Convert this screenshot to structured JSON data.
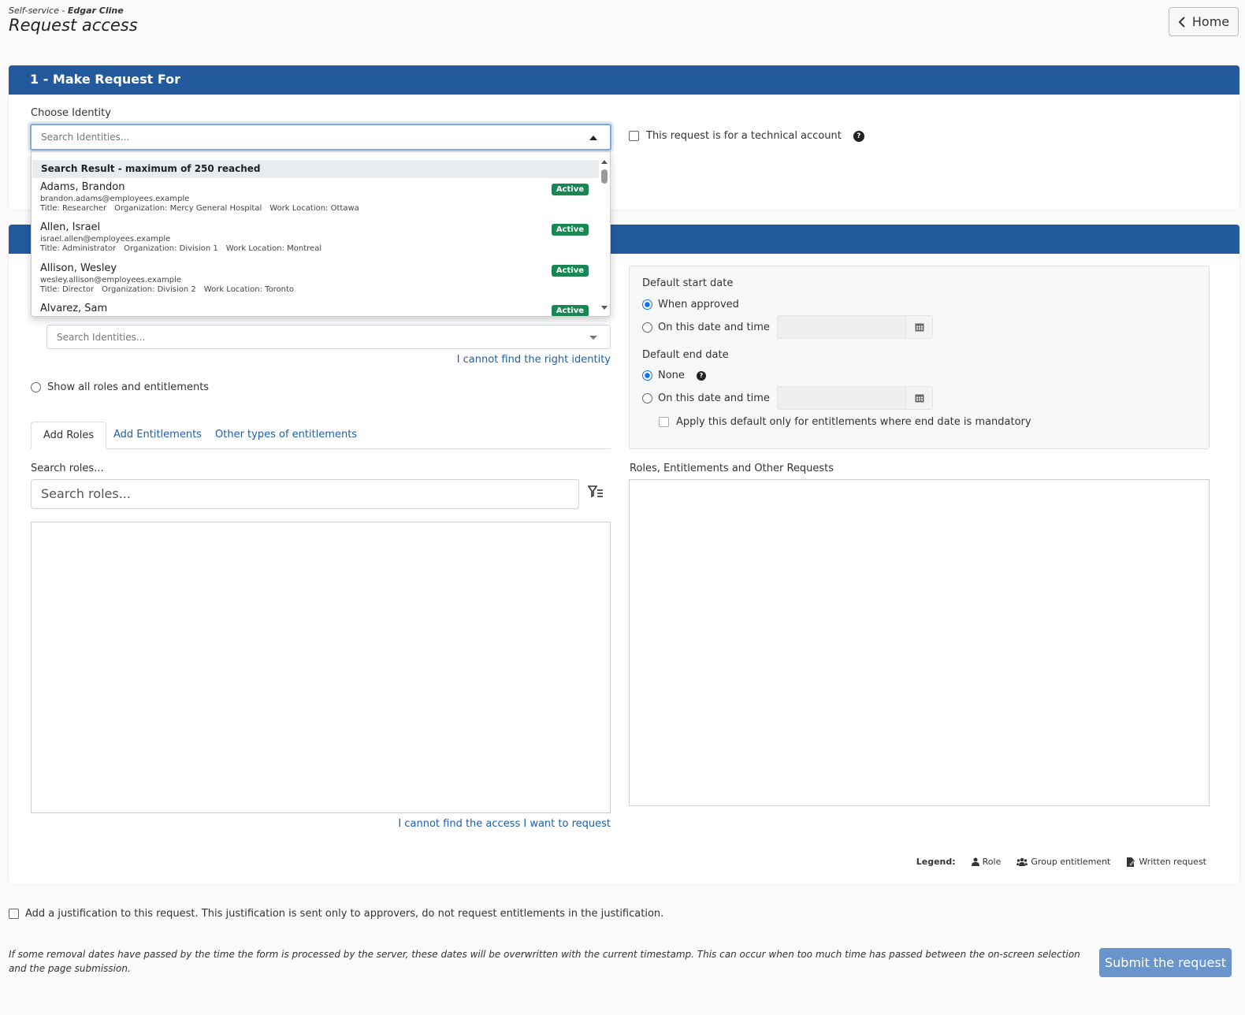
{
  "header": {
    "breadcrumb_prefix": "Self-service - ",
    "breadcrumb_user": "Edgar Cline",
    "title": "Request access",
    "home_label": "Home"
  },
  "section1": {
    "title": "1 - Make Request For",
    "choose_identity_label": "Choose Identity",
    "identity_placeholder": "Search Identities...",
    "technical_account_label": "This request is for a technical account"
  },
  "dropdown": {
    "header": "Search Result - maximum of 250 reached",
    "items": [
      {
        "name": "Adams, Brandon",
        "email": "brandon.adams@employees.example",
        "title": "Title: Researcher",
        "org": "Organization: Mercy General Hospital",
        "location": "Work Location: Ottawa",
        "status": "Active"
      },
      {
        "name": "Allen, Israel",
        "email": "israel.allen@employees.example",
        "title": "Title: Administrator",
        "org": "Organization: Division 1",
        "location": "Work Location: Montreal",
        "status": "Active"
      },
      {
        "name": "Allison, Wesley",
        "email": "wesley.allison@employees.example",
        "title": "Title: Director",
        "org": "Organization: Division 2",
        "location": "Work Location: Toronto",
        "status": "Active"
      },
      {
        "name": "Alvarez, Sam",
        "status": "Active"
      }
    ]
  },
  "section2": {
    "identity_placeholder2": "Search Identities...",
    "cannot_find_identity": "I cannot find the right identity",
    "show_all_label": "Show all roles and entitlements",
    "tabs": [
      "Add Roles",
      "Add Entitlements",
      "Other types of entitlements"
    ],
    "search_roles_label": "Search roles...",
    "search_roles_placeholder": "Search roles...",
    "cannot_find_access": "I cannot find the access I want to request",
    "default_start_label": "Default start date",
    "start_when_approved": "When approved",
    "start_on_date": "On this date and time",
    "default_end_label": "Default end date",
    "end_none": "None",
    "end_on_date": "On this date and time",
    "apply_default": "Apply this default only for entitlements where end date is mandatory",
    "requests_label": "Roles, Entitlements and Other Requests",
    "legend_title": "Legend:",
    "legend_role": "Role",
    "legend_group": "Group entitlement",
    "legend_written": "Written request"
  },
  "footer": {
    "justification_label": "Add a justification to this request. This justification is sent only to approvers, do not request entitlements in the justification.",
    "footnote": "If some removal dates have passed by the time the form is processed by the server, these dates will be overwritten with the current timestamp. This can occur when too much time has passed between the on-screen selection and the page submission.",
    "submit_label": "Submit the request"
  },
  "colors": {
    "header_blue": "#235a9e",
    "active_badge": "#198754",
    "link": "#1f5fa8",
    "submit": "#6a95cc"
  }
}
